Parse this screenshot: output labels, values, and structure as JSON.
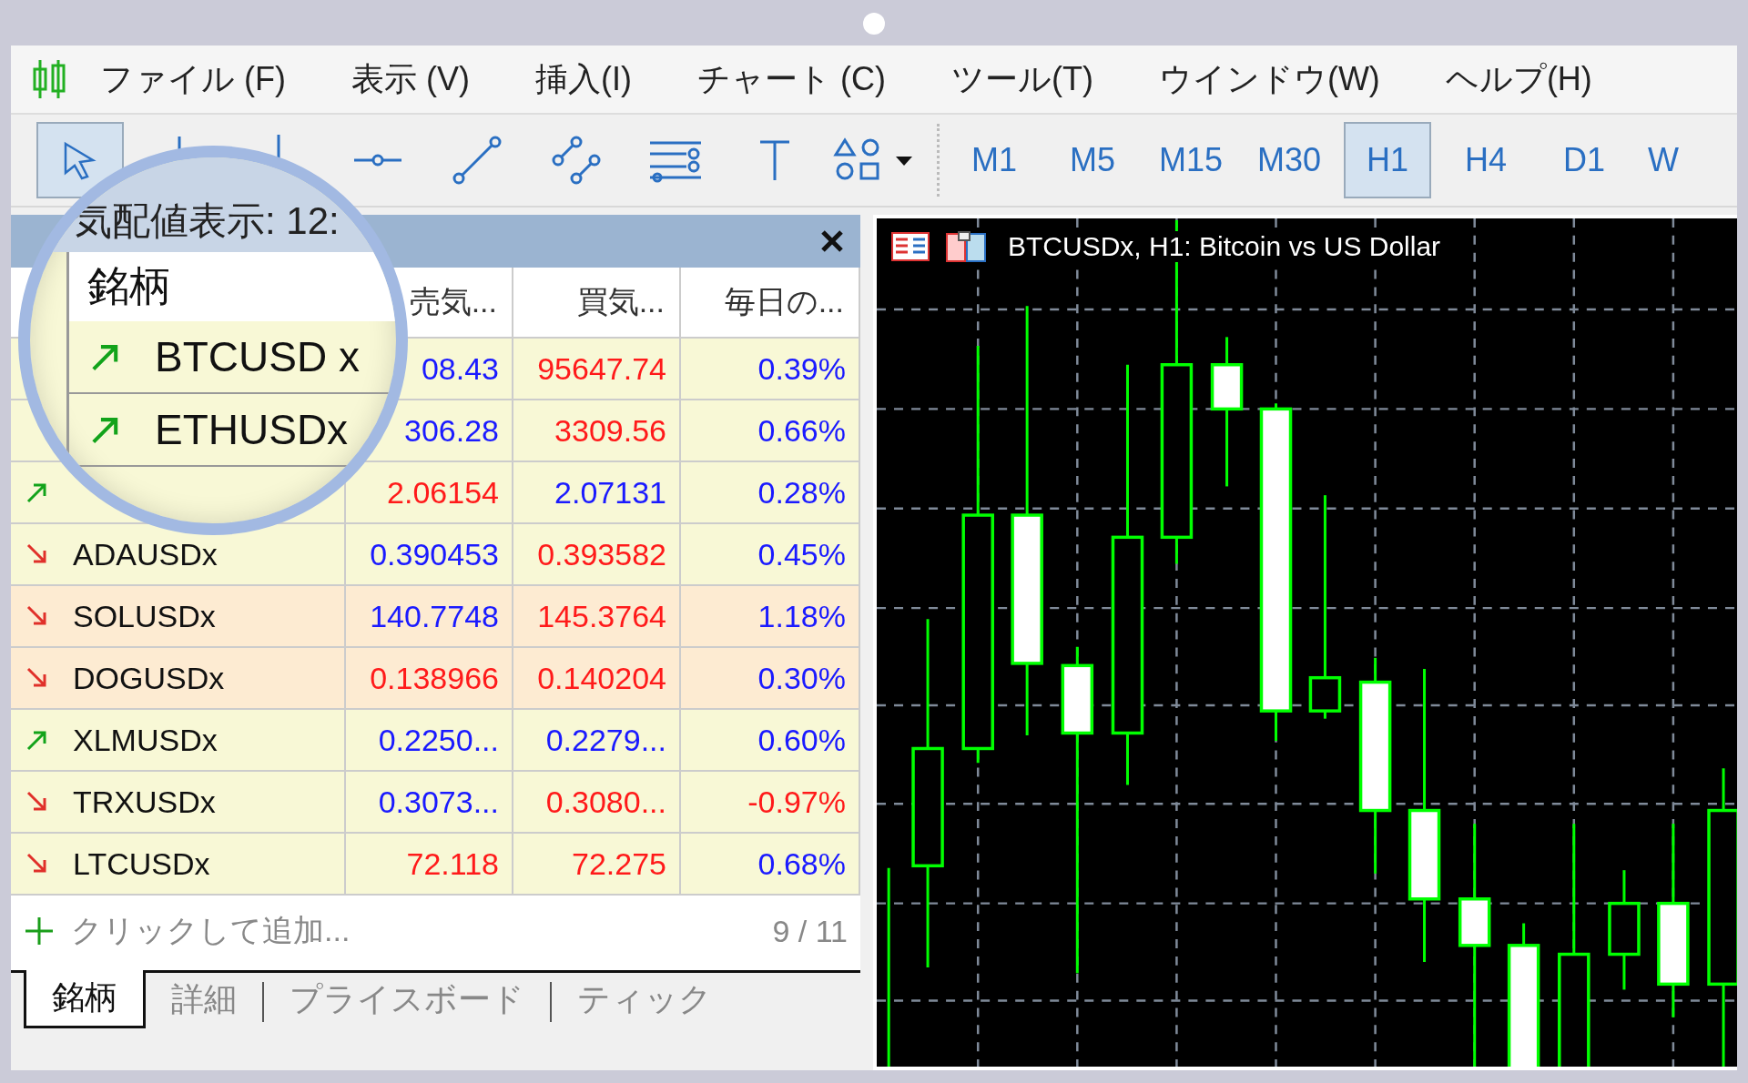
{
  "menu": [
    {
      "label": "ファイル (F)"
    },
    {
      "label": "表示 (V)"
    },
    {
      "label": "挿入(I)"
    },
    {
      "label": "チャート (C)"
    },
    {
      "label": "ツール(T)"
    },
    {
      "label": "ウインドウ(W)"
    },
    {
      "label": "ヘルプ(H)"
    }
  ],
  "tools": [
    {
      "kind": "cursor",
      "selected": true
    },
    {
      "kind": "vline",
      "selected": false
    },
    {
      "kind": "vline-dot",
      "selected": false
    },
    {
      "kind": "hline",
      "selected": false
    },
    {
      "kind": "trend",
      "selected": false
    },
    {
      "kind": "channel",
      "selected": false
    },
    {
      "kind": "fibo",
      "selected": false
    },
    {
      "kind": "text",
      "selected": false
    },
    {
      "kind": "shapes",
      "selected": false
    }
  ],
  "timeframes": [
    {
      "label": "M1",
      "selected": false
    },
    {
      "label": "M5",
      "selected": false
    },
    {
      "label": "M15",
      "selected": false
    },
    {
      "label": "M30",
      "selected": false
    },
    {
      "label": "H1",
      "selected": true
    },
    {
      "label": "H4",
      "selected": false
    },
    {
      "label": "D1",
      "selected": false
    },
    {
      "label": "W",
      "selected": false
    }
  ],
  "market_watch": {
    "columns": [
      "売気...",
      "買気...",
      "毎日の..."
    ],
    "rows": [
      {
        "bid": {
          "text": "08.43",
          "color": "#1a1aff"
        },
        "ask": {
          "text": "95647.74",
          "color": "#ff1a1a"
        },
        "change": {
          "text": "0.39%",
          "color": "#1a1aff"
        },
        "highlight": false
      },
      {
        "bid": {
          "text": "306.28",
          "color": "#1a1aff"
        },
        "ask": {
          "text": "3309.56",
          "color": "#ff1a1a"
        },
        "change": {
          "text": "0.66%",
          "color": "#1a1aff"
        },
        "highlight": false
      },
      {
        "rising": true,
        "bid": {
          "text": "2.06154",
          "color": "#ff1a1a"
        },
        "ask": {
          "text": "2.07131",
          "color": "#1a1aff"
        },
        "change": {
          "text": "0.28%",
          "color": "#1a1aff"
        },
        "highlight": false
      },
      {
        "symbol": "ADAUSDx",
        "rising": false,
        "bid": {
          "text": "0.390453",
          "color": "#1a1aff"
        },
        "ask": {
          "text": "0.393582",
          "color": "#ff1a1a"
        },
        "change": {
          "text": "0.45%",
          "color": "#1a1aff"
        },
        "highlight": false
      },
      {
        "symbol": "SOLUSDx",
        "rising": false,
        "bid": {
          "text": "140.7748",
          "color": "#1a1aff"
        },
        "ask": {
          "text": "145.3764",
          "color": "#ff1a1a"
        },
        "change": {
          "text": "1.18%",
          "color": "#1a1aff"
        },
        "highlight": true
      },
      {
        "symbol": "DOGUSDx",
        "rising": false,
        "bid": {
          "text": "0.138966",
          "color": "#ff1a1a"
        },
        "ask": {
          "text": "0.140204",
          "color": "#ff1a1a"
        },
        "change": {
          "text": "0.30%",
          "color": "#1a1aff"
        },
        "highlight": true
      },
      {
        "symbol": "XLMUSDx",
        "rising": true,
        "bid": {
          "text": "0.2250...",
          "color": "#1a1aff"
        },
        "ask": {
          "text": "0.2279...",
          "color": "#1a1aff"
        },
        "change": {
          "text": "0.60%",
          "color": "#1a1aff"
        },
        "highlight": false
      },
      {
        "symbol": "TRXUSDx",
        "rising": false,
        "bid": {
          "text": "0.3073...",
          "color": "#1a1aff"
        },
        "ask": {
          "text": "0.3080...",
          "color": "#ff1a1a"
        },
        "change": {
          "text": "-0.97%",
          "color": "#ff1a1a"
        },
        "highlight": false
      },
      {
        "symbol": "LTCUSDx",
        "rising": false,
        "bid": {
          "text": "72.118",
          "color": "#ff1a1a"
        },
        "ask": {
          "text": "72.275",
          "color": "#ff1a1a"
        },
        "change": {
          "text": "0.68%",
          "color": "#1a1aff"
        },
        "highlight": false
      }
    ],
    "add_placeholder": "クリックして追加...",
    "count": "9 / 11",
    "tabs": [
      {
        "label": "銘柄",
        "selected": true
      },
      {
        "label": "詳細",
        "selected": false
      },
      {
        "label": "プライスボード",
        "selected": false
      },
      {
        "label": "ティック",
        "selected": false
      }
    ]
  },
  "magnifier": {
    "title": "気配値表示: 12:",
    "column": "銘柄",
    "rows": [
      {
        "symbol": "BTCUSD x",
        "rising": true
      },
      {
        "symbol": "ETHUSDx",
        "rising": true
      }
    ]
  },
  "chart": {
    "title": "BTCUSDx, H1:  Bitcoin vs US Dollar"
  }
}
